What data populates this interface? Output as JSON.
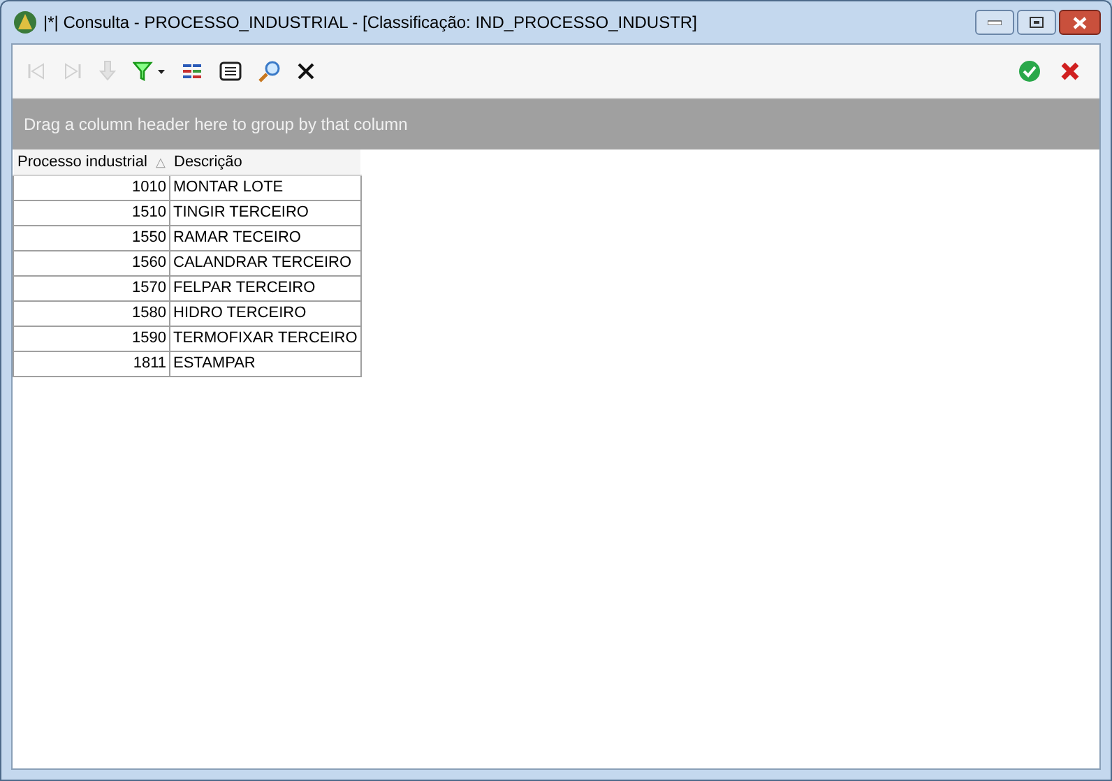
{
  "window": {
    "title": "|*| Consulta - PROCESSO_INDUSTRIAL - [Classificação: IND_PROCESSO_INDUSTR]"
  },
  "toolbar": [
    {
      "kind": "first",
      "disabled": true
    },
    {
      "kind": "last",
      "disabled": true
    },
    {
      "kind": "down",
      "disabled": true
    },
    {
      "kind": "filter",
      "disabled": false
    },
    {
      "kind": "columns",
      "disabled": false
    },
    {
      "kind": "list",
      "disabled": false
    },
    {
      "kind": "search",
      "disabled": false
    },
    {
      "kind": "close",
      "disabled": false
    }
  ],
  "actions": [
    {
      "kind": "confirm"
    },
    {
      "kind": "cancel"
    }
  ],
  "group_panel": {
    "hint": "Drag a column header here to group by that column"
  },
  "table": {
    "columns": [
      {
        "label": "Processo industrial",
        "sort_mark": "△"
      },
      {
        "label": "Descrição"
      }
    ],
    "rows": [
      [
        "1010",
        "MONTAR LOTE"
      ],
      [
        "1510",
        "TINGIR TERCEIRO"
      ],
      [
        "1550",
        "RAMAR TECEIRO"
      ],
      [
        "1560",
        "CALANDRAR TERCEIRO"
      ],
      [
        "1570",
        "FELPAR TERCEIRO"
      ],
      [
        "1580",
        "HIDRO TERCEIRO"
      ],
      [
        "1590",
        "TERMOFIXAR TERCEIRO"
      ],
      [
        "1811",
        "ESTAMPAR"
      ]
    ]
  }
}
